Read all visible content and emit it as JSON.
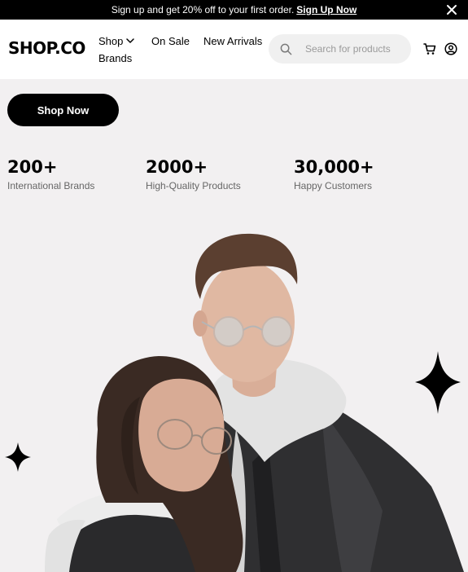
{
  "promo": {
    "text": "Sign up and get 20% off to your first order.",
    "link": "Sign Up Now"
  },
  "header": {
    "logo": "SHOP.CO",
    "nav": {
      "shop": "Shop",
      "on_sale": "On Sale",
      "new_arrivals": "New Arrivals",
      "brands": "Brands"
    },
    "search": {
      "placeholder": "Search for products",
      "value": ""
    }
  },
  "hero": {
    "cta": "Shop Now",
    "stats": [
      {
        "value": "200+",
        "label": "International Brands"
      },
      {
        "value": "2000+",
        "label": "High-Quality Products"
      },
      {
        "value": "30,000+",
        "label": "Happy Customers"
      }
    ]
  },
  "colors": {
    "accent": "#000000",
    "background": "#f2f0f1",
    "header_bg": "#ffffff",
    "search_bg": "#f0f0f0",
    "muted_text": "#666666"
  },
  "icons": [
    "close-icon",
    "chevron-down-icon",
    "search-icon",
    "cart-icon",
    "user-icon",
    "sparkle-icon"
  ]
}
